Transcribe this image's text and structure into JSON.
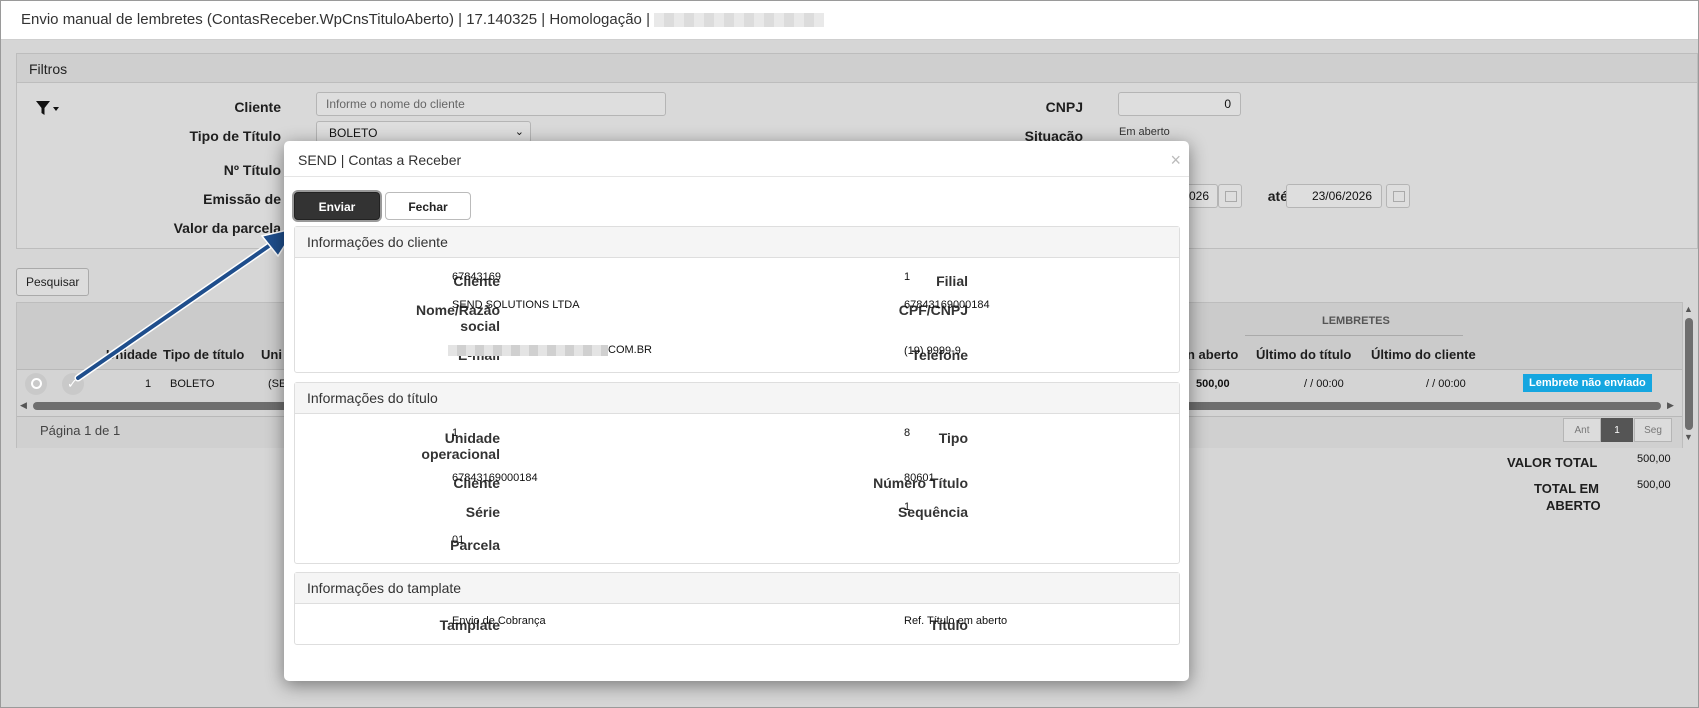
{
  "window": {
    "title": "Envio manual de lembretes (ContasReceber.WpCnsTituloAberto) | 17.140325 | Homologação |"
  },
  "filters": {
    "header": "Filtros",
    "filter_icon": "filter-icon",
    "cliente_label": "Cliente",
    "cliente_placeholder": "Informe o nome do cliente",
    "tipo_label": "Tipo de Título",
    "tipo_value": "BOLETO",
    "numero_label": "Nº Título",
    "emissao_label": "Emissão de",
    "valor_label": "Valor da parcela",
    "cnpj_label": "CNPJ",
    "cnpj_value": "0",
    "situacao_label": "Situação",
    "situacao_value": "Em aberto",
    "date_from_partial": "026",
    "ate_label": "até",
    "date_to": "23/06/2026"
  },
  "toolbar": {
    "search_label": "Pesquisar"
  },
  "table": {
    "group_header": "LEMBRETES",
    "headers": {
      "unidade": "Unidade",
      "tipo": "Tipo de título",
      "uni_partial": "Uni",
      "aberto_partial": "n aberto",
      "ultimo_titulo": "Último do título",
      "ultimo_cliente": "Último do cliente"
    },
    "row": {
      "unidade": "1",
      "tipo": "BOLETO",
      "uni_partial": "(SE",
      "valor": "500,00",
      "ultimo_titulo": "/ / 00:00",
      "ultimo_cliente": "/ / 00:00",
      "status": "Lembrete não enviado"
    },
    "pagination_text": "Página 1 de 1",
    "pager": {
      "prev": "Ant",
      "current": "1",
      "next": "Seg"
    }
  },
  "totals": {
    "valor_total_label": "VALOR TOTAL",
    "valor_total": "500,00",
    "total_aberto_label_1": "TOTAL EM",
    "total_aberto_label_2": "ABERTO",
    "total_aberto": "500,00"
  },
  "modal": {
    "title": "SEND | Contas a Receber",
    "close": "×",
    "send_label": "Enviar",
    "close_label": "Fechar",
    "cliente_section": {
      "title": "Informações do cliente",
      "cliente_label": "Cliente",
      "cliente_value": "67843169",
      "filial_label": "Filial",
      "filial_value": "1",
      "nome_label_1": "Nome/Razão",
      "nome_label_2": "social",
      "nome_value": "SEND SOLUTIONS LTDA",
      "cpf_label": "CPF/CNPJ",
      "cpf_value": "67843169000184",
      "email_label": "E-mail",
      "email_suffix": "COM.BR",
      "telefone_label": "Telefone",
      "telefone_value": "(19) 9999-9"
    },
    "titulo_section": {
      "title": "Informações do título",
      "unidade_label_1": "Unidade",
      "unidade_label_2": "operacional",
      "unidade_value": "1",
      "tipo_label": "Tipo",
      "tipo_value": "8",
      "cliente_label": "Cliente",
      "cliente_value": "67843169000184",
      "numero_label": "Número Título",
      "numero_value": "80601",
      "serie_label": "Série",
      "sequencia_label": "Sequência",
      "sequencia_value": "1",
      "parcela_label": "Parcela",
      "parcela_value": "01"
    },
    "template_section": {
      "title": "Informações do tamplate",
      "template_label": "Tamplate",
      "template_value": "Envio de Cobrança",
      "titulo_label": "Título",
      "titulo_value": "Ref. Título em aberto"
    }
  },
  "colors": {
    "badge": "#15a6e0",
    "primary_button": "#333333",
    "arrow": "#1f4e8c"
  }
}
